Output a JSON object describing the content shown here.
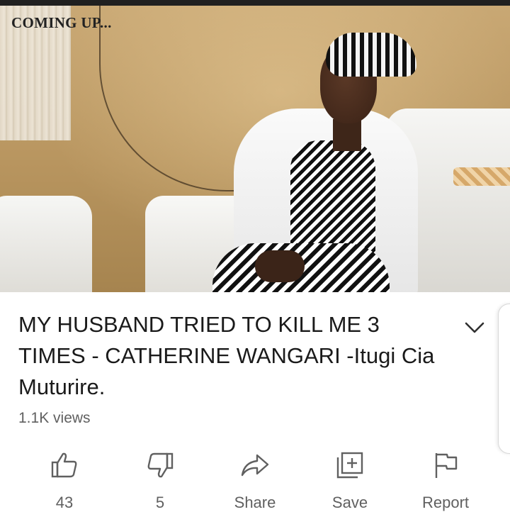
{
  "video": {
    "overlay_text": "COMING UP..."
  },
  "title": "MY HUSBAND TRIED TO KILL ME 3 TIMES - CATHERINE WANGARI -Itugi Cia Muturire.",
  "views": "1.1K views",
  "actions": {
    "like": {
      "label": "43",
      "icon": "thumbs-up-icon"
    },
    "dislike": {
      "label": "5",
      "icon": "thumbs-down-icon"
    },
    "share": {
      "label": "Share",
      "icon": "share-arrow-icon"
    },
    "save": {
      "label": "Save",
      "icon": "add-to-playlist-icon"
    },
    "report": {
      "label": "Report",
      "icon": "flag-icon"
    }
  },
  "colors": {
    "text_primary": "#1a1a1a",
    "text_secondary": "#606060",
    "icon": "#606060"
  }
}
